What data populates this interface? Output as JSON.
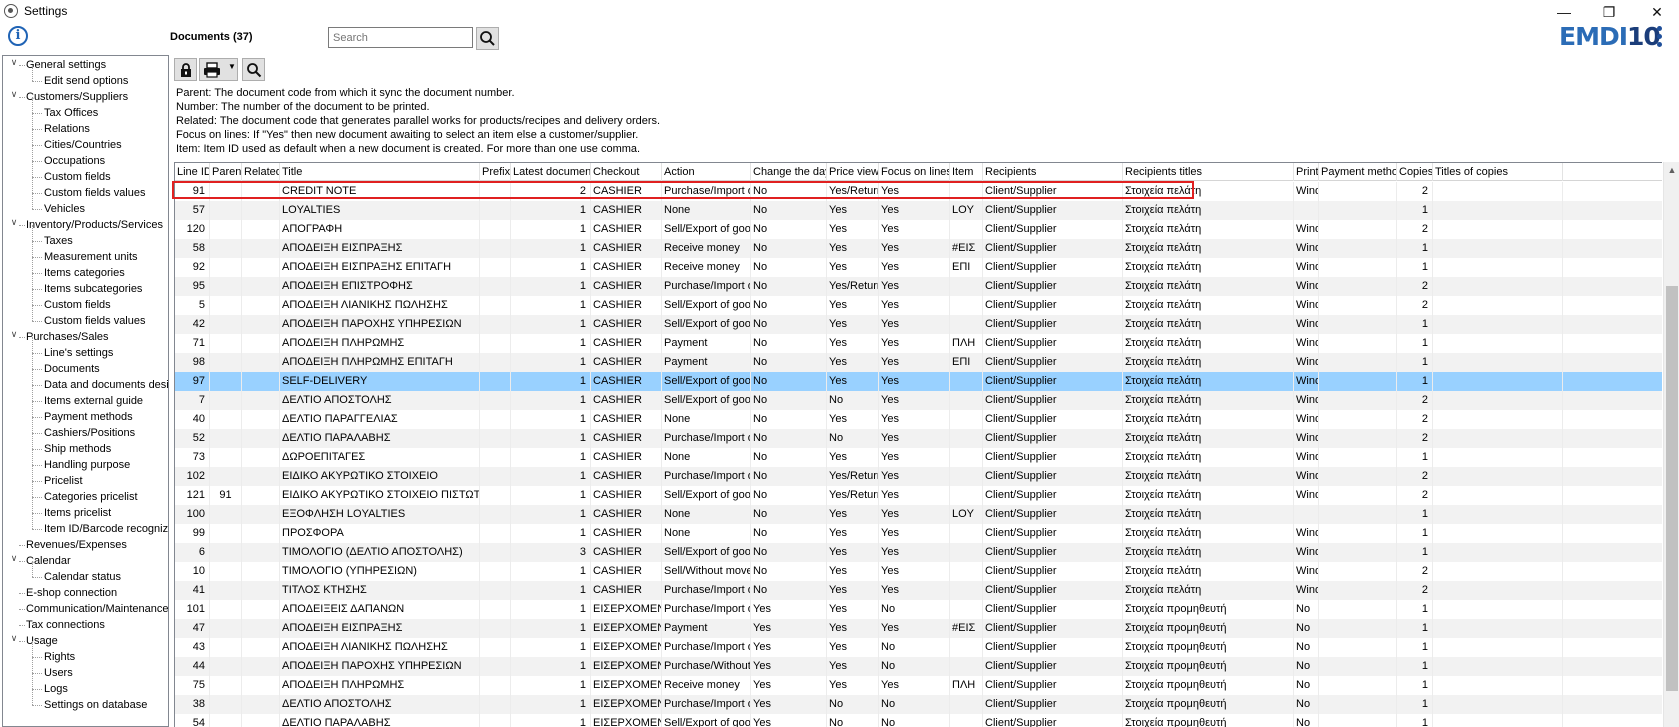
{
  "window": {
    "title": "Settings"
  },
  "header": {
    "doc_title": "Documents (37)",
    "search_placeholder": "Search",
    "logo_part1": "EMDI",
    "logo_part2": "10"
  },
  "help_lines": [
    "Parent: The document code from which it sync the document number.",
    "Number: The number of the document to be printed.",
    "Related: The document code that generates parallel works for products/recipes and delivery orders.",
    "Focus on lines: If \"Yes\" then new document awaiting to select an item else a customer/supplier.",
    "Item: Item ID used as default when a new document is created. For more than one use comma."
  ],
  "sidebar": [
    {
      "label": "General settings",
      "level": 0,
      "expanded": true
    },
    {
      "label": "Edit send options",
      "level": 1
    },
    {
      "label": "Customers/Suppliers",
      "level": 0,
      "expanded": true
    },
    {
      "label": "Tax Offices",
      "level": 1
    },
    {
      "label": "Relations",
      "level": 1
    },
    {
      "label": "Cities/Countries",
      "level": 1
    },
    {
      "label": "Occupations",
      "level": 1
    },
    {
      "label": "Custom fields",
      "level": 1
    },
    {
      "label": "Custom fields values",
      "level": 1
    },
    {
      "label": "Vehicles",
      "level": 1
    },
    {
      "label": "Inventory/Products/Services",
      "level": 0,
      "expanded": true
    },
    {
      "label": "Taxes",
      "level": 1
    },
    {
      "label": "Measurement units",
      "level": 1
    },
    {
      "label": "Items categories",
      "level": 1
    },
    {
      "label": "Items subcategories",
      "level": 1
    },
    {
      "label": "Custom fields",
      "level": 1
    },
    {
      "label": "Custom fields values",
      "level": 1
    },
    {
      "label": "Purchases/Sales",
      "level": 0,
      "expanded": true
    },
    {
      "label": "Line's settings",
      "level": 1
    },
    {
      "label": "Documents",
      "level": 1
    },
    {
      "label": "Data and documents desi",
      "level": 1
    },
    {
      "label": "Items external guide",
      "level": 1
    },
    {
      "label": "Payment methods",
      "level": 1
    },
    {
      "label": "Cashiers/Positions",
      "level": 1
    },
    {
      "label": "Ship methods",
      "level": 1
    },
    {
      "label": "Handling purpose",
      "level": 1
    },
    {
      "label": "Pricelist",
      "level": 1
    },
    {
      "label": "Categories pricelist",
      "level": 1
    },
    {
      "label": "Items pricelist",
      "level": 1
    },
    {
      "label": "Item ID/Barcode recogniz",
      "level": 1
    },
    {
      "label": "Revenues/Expenses",
      "level": 0
    },
    {
      "label": "Calendar",
      "level": 0,
      "expanded": true
    },
    {
      "label": "Calendar status",
      "level": 1
    },
    {
      "label": "E-shop connection",
      "level": 0
    },
    {
      "label": "Communication/Maintenance",
      "level": 0
    },
    {
      "label": "Tax connections",
      "level": 0
    },
    {
      "label": "Usage",
      "level": 0,
      "expanded": true
    },
    {
      "label": "Rights",
      "level": 1
    },
    {
      "label": "Users",
      "level": 1
    },
    {
      "label": "Logs",
      "level": 1
    },
    {
      "label": "Settings on database",
      "level": 1
    }
  ],
  "table": {
    "columns": [
      "Line ID",
      "Parent",
      "Related",
      "Title",
      "Prefix",
      "Latest document",
      "Checkout",
      "Action",
      "Change the day",
      "Price view",
      "Focus on lines",
      "Item",
      "Recipients",
      "Recipients titles",
      "Print",
      "Payment method",
      "Copies",
      "Titles of copies"
    ],
    "selected_index": 10,
    "rows": [
      [
        "91",
        "",
        "",
        "CREDIT NOTE",
        "",
        "2",
        "CASHIER",
        "Purchase/Import of",
        "No",
        "Yes/Return",
        "Yes",
        "",
        "Client/Supplier",
        "Στοιχεία πελάτη",
        "Wind",
        "",
        "2",
        ""
      ],
      [
        "57",
        "",
        "",
        "LOYALTIES",
        "",
        "1",
        "CASHIER",
        "None",
        "No",
        "Yes",
        "Yes",
        "LOY",
        "Client/Supplier",
        "Στοιχεία πελάτη",
        "",
        "",
        "1",
        ""
      ],
      [
        "120",
        "",
        "",
        "ΑΠΟΓΡΑΦΗ",
        "",
        "1",
        "CASHIER",
        "Sell/Export of good",
        "No",
        "Yes",
        "Yes",
        "",
        "Client/Supplier",
        "Στοιχεία πελάτη",
        "Wind",
        "",
        "2",
        ""
      ],
      [
        "58",
        "",
        "",
        "ΑΠΟΔΕΙΞΗ ΕΙΣΠΡΑΞΗΣ",
        "",
        "1",
        "CASHIER",
        "Receive money",
        "No",
        "Yes",
        "Yes",
        "#ΕΙΣ",
        "Client/Supplier",
        "Στοιχεία πελάτη",
        "Wind",
        "",
        "1",
        ""
      ],
      [
        "92",
        "",
        "",
        "ΑΠΟΔΕΙΞΗ ΕΙΣΠΡΑΞΗΣ ΕΠΙΤΑΓΗ",
        "",
        "1",
        "CASHIER",
        "Receive money",
        "No",
        "Yes",
        "Yes",
        "ΕΠΙ",
        "Client/Supplier",
        "Στοιχεία πελάτη",
        "Wind",
        "",
        "1",
        ""
      ],
      [
        "95",
        "",
        "",
        "ΑΠΟΔΕΙΞΗ ΕΠΙΣΤΡΟΦΗΣ",
        "",
        "1",
        "CASHIER",
        "Purchase/Import of",
        "No",
        "Yes/Return",
        "Yes",
        "",
        "Client/Supplier",
        "Στοιχεία πελάτη",
        "Wind",
        "",
        "2",
        ""
      ],
      [
        "5",
        "",
        "",
        "ΑΠΟΔΕΙΞΗ ΛΙΑΝΙΚΗΣ ΠΩΛΗΣΗΣ",
        "",
        "1",
        "CASHIER",
        "Sell/Export of good",
        "No",
        "Yes",
        "Yes",
        "",
        "Client/Supplier",
        "Στοιχεία πελάτη",
        "Wind",
        "",
        "2",
        ""
      ],
      [
        "42",
        "",
        "",
        "ΑΠΟΔΕΙΞΗ ΠΑΡΟΧΗΣ ΥΠΗΡΕΣΙΩΝ",
        "",
        "1",
        "CASHIER",
        "Sell/Export of good",
        "No",
        "Yes",
        "Yes",
        "",
        "Client/Supplier",
        "Στοιχεία πελάτη",
        "Wind",
        "",
        "1",
        ""
      ],
      [
        "71",
        "",
        "",
        "ΑΠΟΔΕΙΞΗ ΠΛΗΡΩΜΗΣ",
        "",
        "1",
        "CASHIER",
        "Payment",
        "No",
        "Yes",
        "Yes",
        "ΠΛΗ",
        "Client/Supplier",
        "Στοιχεία πελάτη",
        "Wind",
        "",
        "1",
        ""
      ],
      [
        "98",
        "",
        "",
        "ΑΠΟΔΕΙΞΗ ΠΛΗΡΩΜΗΣ ΕΠΙΤΑΓΗ",
        "",
        "1",
        "CASHIER",
        "Payment",
        "No",
        "Yes",
        "Yes",
        "ΕΠΙ",
        "Client/Supplier",
        "Στοιχεία πελάτη",
        "Wind",
        "",
        "1",
        ""
      ],
      [
        "97",
        "",
        "",
        "SELF-DELIVERY",
        "",
        "1",
        "CASHIER",
        "Sell/Export of good",
        "No",
        "Yes",
        "Yes",
        "",
        "Client/Supplier",
        "Στοιχεία πελάτη",
        "Wind",
        "",
        "1",
        ""
      ],
      [
        "7",
        "",
        "",
        "ΔΕΛΤΙΟ ΑΠΟΣΤΟΛΗΣ",
        "",
        "1",
        "CASHIER",
        "Sell/Export of good",
        "No",
        "No",
        "Yes",
        "",
        "Client/Supplier",
        "Στοιχεία πελάτη",
        "Wind",
        "",
        "2",
        ""
      ],
      [
        "40",
        "",
        "",
        "ΔΕΛΤΙΟ ΠΑΡΑΓΓΕΛΙΑΣ",
        "",
        "1",
        "CASHIER",
        "None",
        "No",
        "Yes",
        "Yes",
        "",
        "Client/Supplier",
        "Στοιχεία πελάτη",
        "Wind",
        "",
        "2",
        ""
      ],
      [
        "52",
        "",
        "",
        "ΔΕΛΤΙΟ ΠΑΡΑΛΑΒΗΣ",
        "",
        "1",
        "CASHIER",
        "Purchase/Import of",
        "No",
        "No",
        "Yes",
        "",
        "Client/Supplier",
        "Στοιχεία πελάτη",
        "Wind",
        "",
        "2",
        ""
      ],
      [
        "73",
        "",
        "",
        "ΔΩΡΟΕΠΙΤΑΓΕΣ",
        "",
        "1",
        "CASHIER",
        "None",
        "No",
        "Yes",
        "Yes",
        "",
        "Client/Supplier",
        "Στοιχεία πελάτη",
        "Wind",
        "",
        "1",
        ""
      ],
      [
        "102",
        "",
        "",
        "ΕΙΔΙΚΟ ΑΚΥΡΩΤΙΚΟ ΣΤΟΙΧΕΙΟ",
        "",
        "1",
        "CASHIER",
        "Purchase/Import of",
        "No",
        "Yes/Return",
        "Yes",
        "",
        "Client/Supplier",
        "Στοιχεία πελάτη",
        "Wind",
        "",
        "2",
        ""
      ],
      [
        "121",
        "91",
        "",
        "ΕΙΔΙΚΟ ΑΚΥΡΩΤΙΚΟ ΣΤΟΙΧΕΙΟ ΠΙΣΤΩΤΙΚΟ",
        "",
        "1",
        "CASHIER",
        "Sell/Export of good",
        "No",
        "Yes/Return",
        "Yes",
        "",
        "Client/Supplier",
        "Στοιχεία πελάτη",
        "Wind",
        "",
        "2",
        ""
      ],
      [
        "100",
        "",
        "",
        "ΕΞΟΦΛΗΣΗ LOYALTIES",
        "",
        "1",
        "CASHIER",
        "None",
        "No",
        "Yes",
        "Yes",
        "LOY",
        "Client/Supplier",
        "Στοιχεία πελάτη",
        "",
        "",
        "1",
        ""
      ],
      [
        "99",
        "",
        "",
        "ΠΡΟΣΦΟΡΑ",
        "",
        "1",
        "CASHIER",
        "None",
        "No",
        "Yes",
        "Yes",
        "",
        "Client/Supplier",
        "Στοιχεία πελάτη",
        "Wind",
        "",
        "1",
        ""
      ],
      [
        "6",
        "",
        "",
        "ΤΙΜΟΛΟΓΙΟ (ΔΕΛΤΙΟ ΑΠΟΣΤΟΛΗΣ)",
        "",
        "3",
        "CASHIER",
        "Sell/Export of good",
        "No",
        "Yes",
        "Yes",
        "",
        "Client/Supplier",
        "Στοιχεία πελάτη",
        "Wind",
        "",
        "1",
        ""
      ],
      [
        "10",
        "",
        "",
        "ΤΙΜΟΛΟΓΙΟ (ΥΠΗΡΕΣΙΩΝ)",
        "",
        "1",
        "CASHIER",
        "Sell/Without mover",
        "No",
        "Yes",
        "Yes",
        "",
        "Client/Supplier",
        "Στοιχεία πελάτη",
        "Wind",
        "",
        "2",
        ""
      ],
      [
        "41",
        "",
        "",
        "ΤΙΤΛΟΣ ΚΤΗΣΗΣ",
        "",
        "1",
        "CASHIER",
        "Purchase/Import of",
        "No",
        "Yes",
        "Yes",
        "",
        "Client/Supplier",
        "Στοιχεία πελάτη",
        "Wind",
        "",
        "2",
        ""
      ],
      [
        "101",
        "",
        "",
        "ΑΠΟΔΕΙΞΕΙΣ ΔΑΠΑΝΩΝ",
        "",
        "1",
        "ΕΙΣΕΡΧΟΜΕΝΑ",
        "Purchase/Import of",
        "Yes",
        "Yes",
        "No",
        "",
        "Client/Supplier",
        "Στοιχεία προμηθευτή",
        "No",
        "",
        "1",
        ""
      ],
      [
        "47",
        "",
        "",
        "ΑΠΟΔΕΙΞΗ ΕΙΣΠΡΑΞΗΣ",
        "",
        "1",
        "ΕΙΣΕΡΧΟΜΕΝΑ",
        "Payment",
        "Yes",
        "Yes",
        "Yes",
        "#ΕΙΣ",
        "Client/Supplier",
        "Στοιχεία προμηθευτή",
        "No",
        "",
        "1",
        ""
      ],
      [
        "43",
        "",
        "",
        "ΑΠΟΔΕΙΞΗ ΛΙΑΝΙΚΗΣ ΠΩΛΗΣΗΣ",
        "",
        "1",
        "ΕΙΣΕΡΧΟΜΕΝΑ",
        "Purchase/Import of",
        "Yes",
        "Yes",
        "No",
        "",
        "Client/Supplier",
        "Στοιχεία προμηθευτή",
        "No",
        "",
        "1",
        ""
      ],
      [
        "44",
        "",
        "",
        "ΑΠΟΔΕΙΞΗ ΠΑΡΟΧΗΣ ΥΠΗΡΕΣΙΩΝ",
        "",
        "1",
        "ΕΙΣΕΡΧΟΜΕΝΑ",
        "Purchase/Without r",
        "Yes",
        "Yes",
        "No",
        "",
        "Client/Supplier",
        "Στοιχεία προμηθευτή",
        "No",
        "",
        "1",
        ""
      ],
      [
        "75",
        "",
        "",
        "ΑΠΟΔΕΙΞΗ ΠΛΗΡΩΜΗΣ",
        "",
        "1",
        "ΕΙΣΕΡΧΟΜΕΝΑ",
        "Receive money",
        "Yes",
        "Yes",
        "Yes",
        "ΠΛΗ",
        "Client/Supplier",
        "Στοιχεία προμηθευτή",
        "No",
        "",
        "1",
        ""
      ],
      [
        "38",
        "",
        "",
        "ΔΕΛΤΙΟ ΑΠΟΣΤΟΛΗΣ",
        "",
        "1",
        "ΕΙΣΕΡΧΟΜΕΝΑ",
        "Purchase/Import of",
        "Yes",
        "No",
        "No",
        "",
        "Client/Supplier",
        "Στοιχεία προμηθευτή",
        "No",
        "",
        "1",
        ""
      ],
      [
        "54",
        "",
        "",
        "ΔΕΛΤΙΟ ΠΑΡΑΛΑΒΗΣ",
        "",
        "1",
        "ΕΙΣΕΡΧΟΜΕΝΑ",
        "Sell/Export of good",
        "Yes",
        "No",
        "No",
        "",
        "Client/Supplier",
        "Στοιχεία προμηθευτή",
        "No",
        "",
        "1",
        ""
      ]
    ]
  },
  "colors": {
    "selected_row": "#99d1ff",
    "alt_row": "#f2f2f2",
    "highlight_box": "#e02020",
    "logo_primary": "#2b6cb6",
    "logo_secondary": "#1b3d7a"
  }
}
